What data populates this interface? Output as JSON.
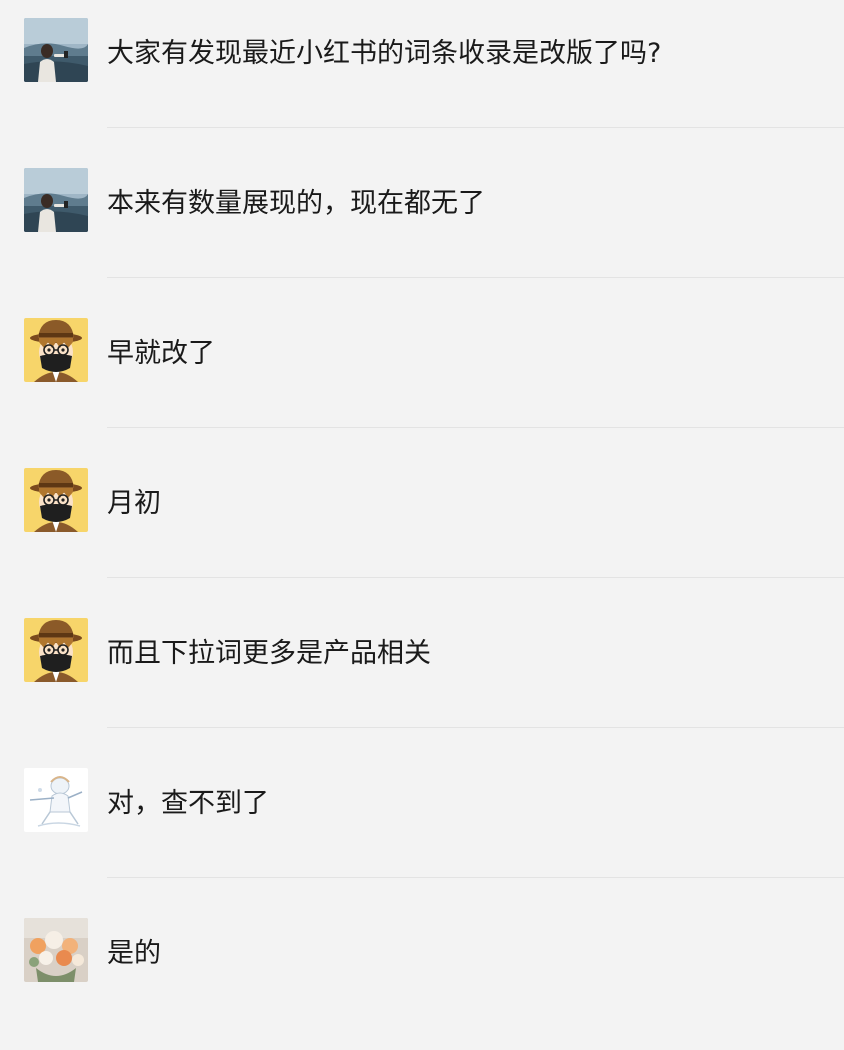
{
  "messages": [
    {
      "avatar": "landscape",
      "avatar_icon": "user-avatar-landscape-icon",
      "name": "",
      "text": "大家有发现最近小红书的词条收录是改版了吗?"
    },
    {
      "avatar": "landscape",
      "avatar_icon": "user-avatar-landscape-icon",
      "name": "",
      "text": "本来有数量展现的，现在都无了"
    },
    {
      "avatar": "masked",
      "avatar_icon": "user-avatar-masked-cartoon-icon",
      "name": "",
      "text": "早就改了"
    },
    {
      "avatar": "masked",
      "avatar_icon": "user-avatar-masked-cartoon-icon",
      "name": "",
      "text": "月初"
    },
    {
      "avatar": "masked",
      "avatar_icon": "user-avatar-masked-cartoon-icon",
      "name": "",
      "text": "而且下拉词更多是产品相关"
    },
    {
      "avatar": "sketch",
      "avatar_icon": "user-avatar-sketch-icon",
      "name": "",
      "text": "对，查不到了"
    },
    {
      "avatar": "flowers",
      "avatar_icon": "user-avatar-flowers-icon",
      "name": "",
      "text": "是的"
    }
  ]
}
